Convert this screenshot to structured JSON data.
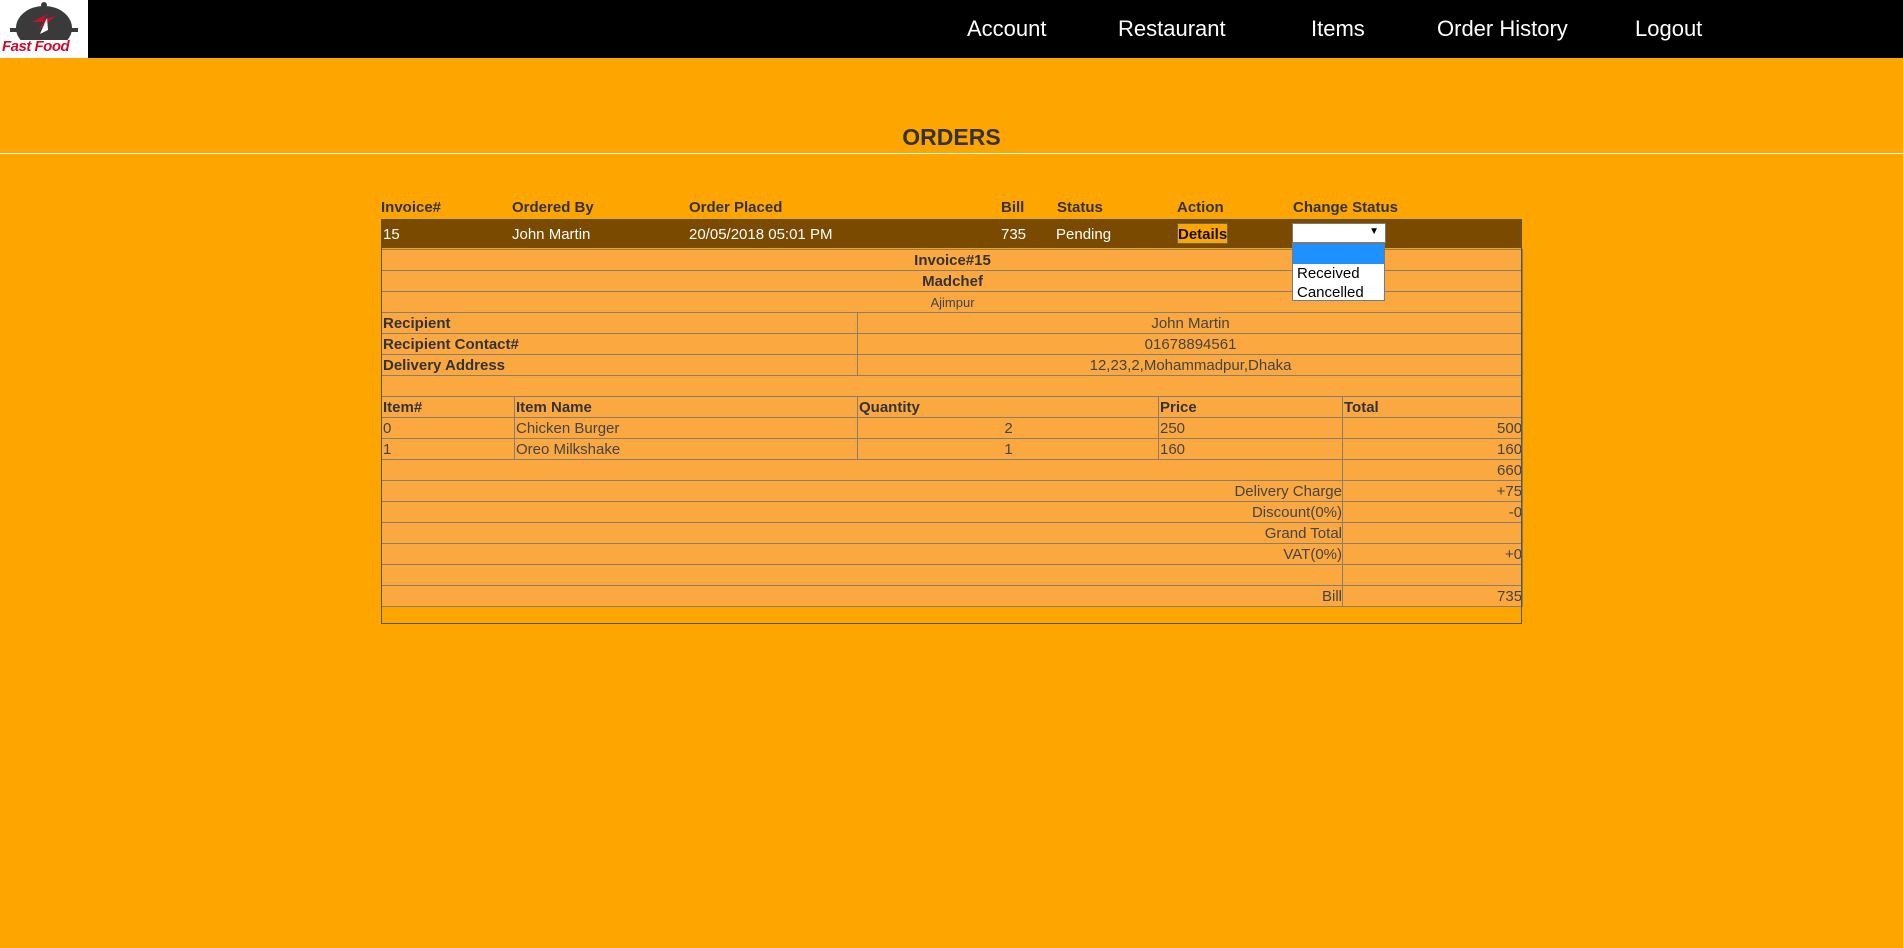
{
  "brand": {
    "logo_text": "Fast Food"
  },
  "nav": {
    "account": "Account",
    "restaurant": "Restaurant",
    "items": "Items",
    "order_history": "Order History",
    "logout": "Logout"
  },
  "page": {
    "title": "ORDERS"
  },
  "orders_table": {
    "headers": {
      "invoice": "Invoice#",
      "ordered_by": "Ordered By",
      "order_placed": "Order Placed",
      "bill": "Bill",
      "status": "Status",
      "action": "Action",
      "change_status": "Change Status"
    },
    "row": {
      "invoice": "15",
      "ordered_by": "John Martin",
      "order_placed": "20/05/2018 05:01 PM",
      "bill": "735",
      "status": "Pending",
      "action_label": "Details",
      "status_select_value": ""
    },
    "status_options": [
      "",
      "Received",
      "Cancelled"
    ]
  },
  "details": {
    "invoice_title": "Invoice#15",
    "restaurant_name": "Madchef",
    "restaurant_area": "Ajimpur",
    "recipient_label": "Recipient",
    "recipient_value": "John Martin",
    "contact_label": "Recipient Contact#",
    "contact_value": "01678894561",
    "address_label": "Delivery Address",
    "address_value": "12,23,2,Mohammadpur,Dhaka",
    "item_headers": {
      "item_no": "Item#",
      "item_name": "Item Name",
      "quantity": "Quantity",
      "price": "Price",
      "total": "Total"
    },
    "items": [
      {
        "no": "0",
        "name": "Chicken Burger",
        "qty": "2",
        "price": "250",
        "total": "500"
      },
      {
        "no": "1",
        "name": "Oreo Milkshake",
        "qty": "1",
        "price": "160",
        "total": "160"
      }
    ],
    "subtotal": "660",
    "delivery_label": "Delivery Charge",
    "delivery_value": "+75",
    "discount_label": "Discount(0%)",
    "discount_value": "-0",
    "grand_total_label": "Grand Total",
    "grand_total_value": "",
    "vat_label": "VAT(0%)",
    "vat_value": "+0",
    "bill_label": "Bill",
    "bill_value": "735"
  },
  "colors": {
    "page_bg": "#FFA500",
    "topbar_bg": "#000000",
    "order_row_bg": "#7a4a00",
    "details_bg": "#FBA840",
    "dropdown_highlight": "#1e90ff",
    "logo_red": "#c8102e"
  }
}
